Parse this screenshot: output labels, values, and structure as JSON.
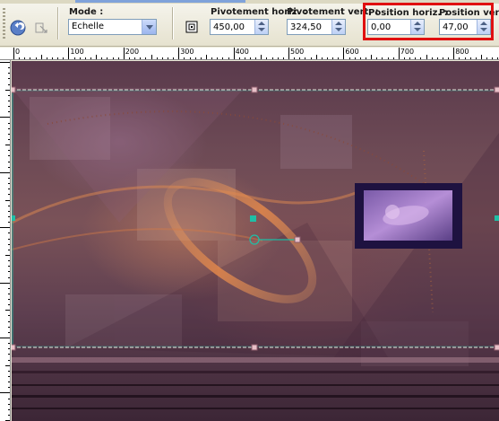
{
  "toolbar": {
    "mode_label": "Mode :",
    "mode_value": "Echelle",
    "pivot_h_label": "Pivotement horiz. :",
    "pivot_h_value": "450,00",
    "pivot_v_label": "Pivotement vert. :",
    "pivot_v_value": "324,50",
    "pos_h_label": "Position horiz. :",
    "pos_h_value": "0,00",
    "pos_v_label": "Position vert. :",
    "pos_v_value": "47,00"
  },
  "ruler": {
    "h_labels": [
      "0",
      "100",
      "200",
      "300",
      "400",
      "500",
      "600",
      "700",
      "800"
    ]
  },
  "colors": {
    "highlight": "#e01010",
    "handle": "#1fbfa6",
    "guide": "#d9d4cc"
  }
}
